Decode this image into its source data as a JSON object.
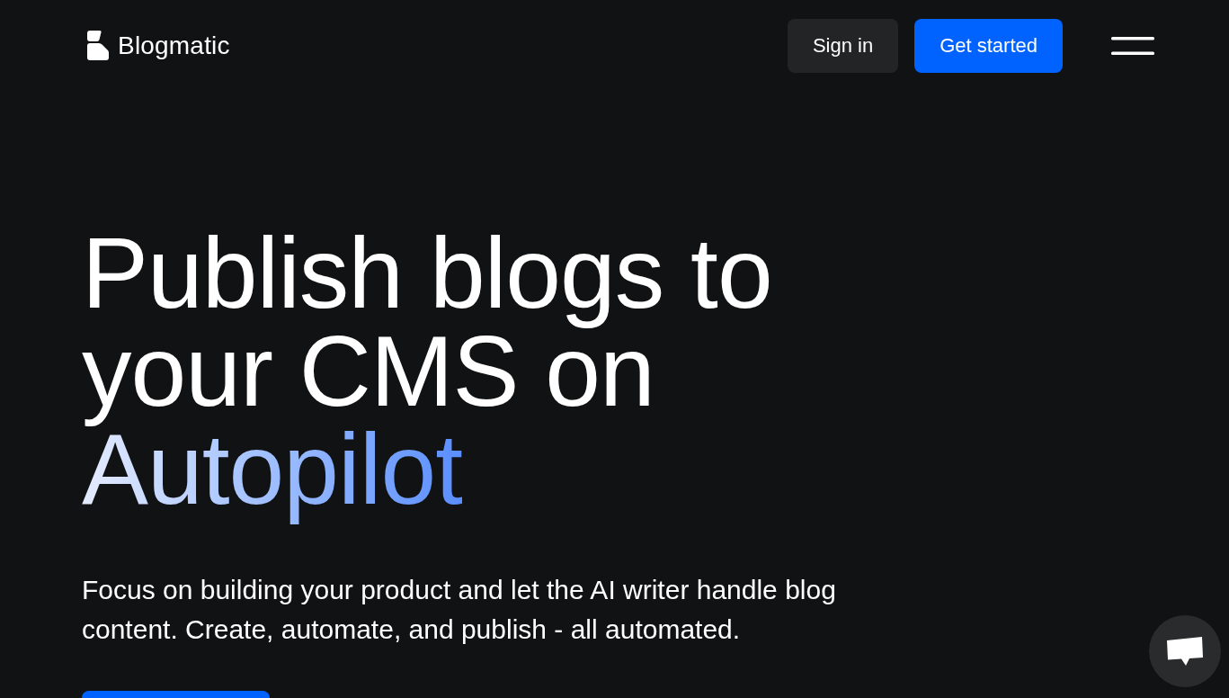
{
  "header": {
    "logo": {
      "name": "Blogmatic"
    },
    "buttons": [
      {
        "label": "Sign in",
        "kind": "secondary"
      },
      {
        "label": "Get started",
        "kind": "primary"
      }
    ]
  },
  "hero": {
    "headline": "Publish blogs to your CMS on",
    "headline_accent": "Autopilot",
    "description": "Focus on building your product and let the AI writer handle blog content. Create, automate, and publish - all automated."
  }
}
